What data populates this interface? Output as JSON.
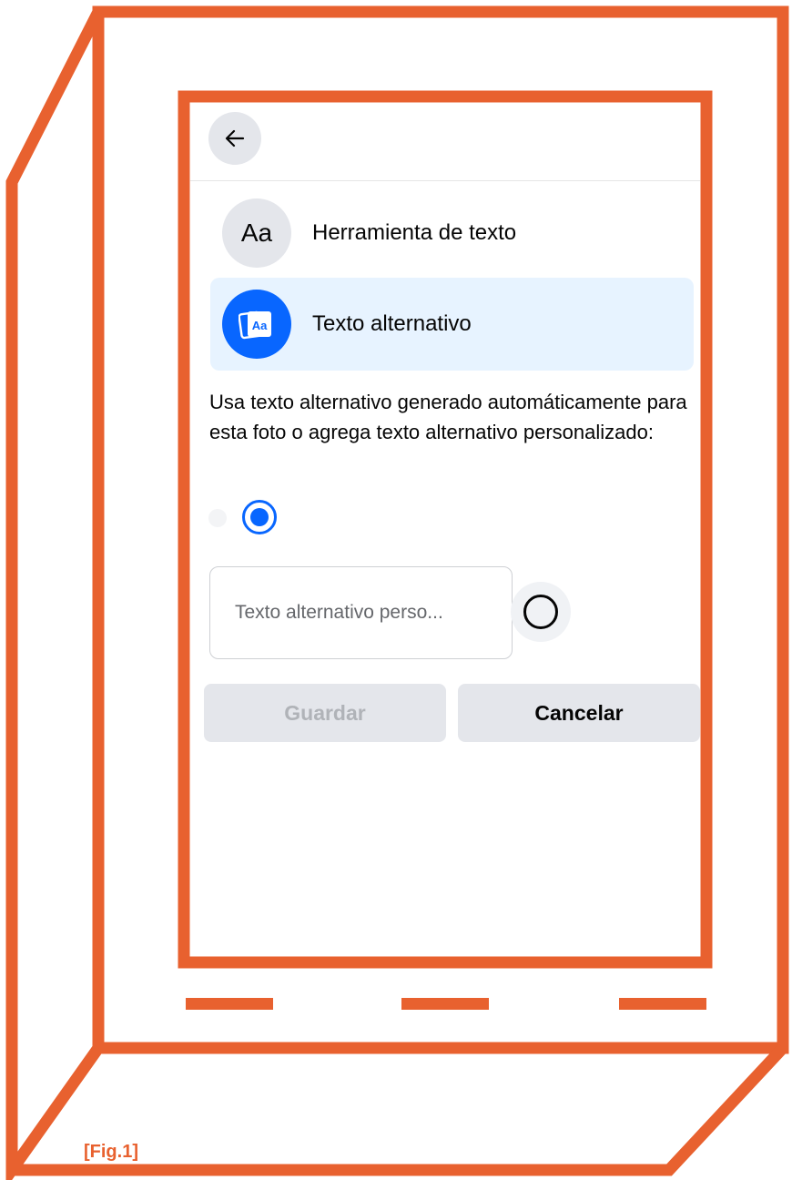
{
  "figure": {
    "label": "[Fig.1]",
    "accent_color": "#e8612f"
  },
  "topbar": {
    "back_icon": "arrow-left-icon"
  },
  "menu": {
    "items": [
      {
        "icon": "Aa",
        "icon_name": "text-tool-icon",
        "label": "Herramienta de texto",
        "selected": false
      },
      {
        "icon": "Aa",
        "icon_name": "alt-text-card-icon",
        "label": "Texto alternativo",
        "selected": true,
        "icon_bg": "#0866ff"
      }
    ]
  },
  "alt_text": {
    "description": "Usa texto alternativo generado automáticamente para esta foto o agrega texto alternativo personalizado:",
    "auto_option_selected": true,
    "custom_placeholder": "Texto alternativo perso...",
    "custom_value": "",
    "custom_option_selected": false
  },
  "actions": {
    "save_label": "Guardar",
    "save_enabled": false,
    "cancel_label": "Cancelar"
  },
  "colors": {
    "primary": "#0866ff",
    "selected_bg": "#e7f3ff",
    "button_bg": "#e4e6eb",
    "frame": "#e8612f"
  }
}
